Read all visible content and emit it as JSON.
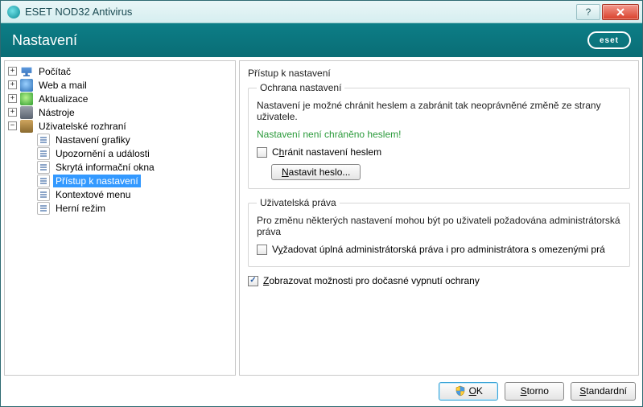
{
  "window": {
    "title": "ESET NOD32 Antivirus",
    "header": "Nastavení",
    "logo": "eset"
  },
  "tree": {
    "items": [
      {
        "label": "Počítač"
      },
      {
        "label": "Web a mail"
      },
      {
        "label": "Aktualizace"
      },
      {
        "label": "Nástroje"
      },
      {
        "label": "Uživatelské rozhraní"
      }
    ],
    "ui_children": [
      {
        "label": "Nastavení grafiky"
      },
      {
        "label": "Upozornění a události"
      },
      {
        "label": "Skrytá informační okna"
      },
      {
        "label": "Přístup k nastavení"
      },
      {
        "label": "Kontextové menu"
      },
      {
        "label": "Herní režim"
      }
    ]
  },
  "content": {
    "page_title": "Přístup k nastavení",
    "g1": {
      "legend": "Ochrana nastavení",
      "desc": "Nastavení je možné chránit heslem a zabránit tak neoprávněné změně ze strany uživatele.",
      "green": "Nastavení není chráněno heslem!",
      "chk_pre": "C",
      "chk_u": "h",
      "chk_post": "ránit nastavení heslem",
      "btn_pre": "",
      "btn_u": "N",
      "btn_post": "astavit heslo..."
    },
    "g2": {
      "legend": "Uživatelská práva",
      "desc": "Pro změnu některých nastavení mohou být po uživateli požadována administrátorská práva",
      "chk_pre": "V",
      "chk_u": "y",
      "chk_post": "žadovat úplná administrátorská práva i pro administrátora s omezenými prá"
    },
    "chk3_pre": "",
    "chk3_u": "Z",
    "chk3_post": "obrazovat možnosti pro dočasné vypnutí ochrany"
  },
  "footer": {
    "ok_u": "O",
    "ok_post": "K",
    "cancel_u": "S",
    "cancel_post": "torno",
    "std_u": "S",
    "std_post": "tandardní"
  }
}
